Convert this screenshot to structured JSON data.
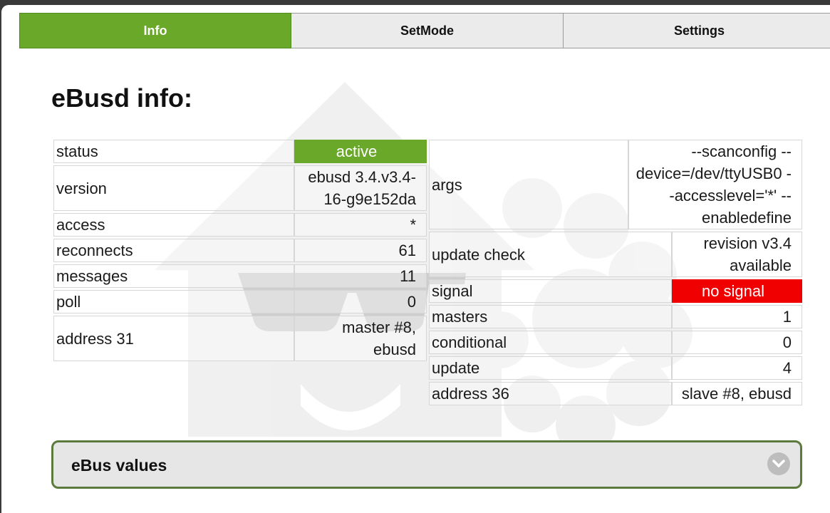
{
  "tabs": [
    {
      "label": "Info",
      "active": true
    },
    {
      "label": "SetMode",
      "active": false
    },
    {
      "label": "Settings",
      "active": false
    }
  ],
  "heading": "eBusd info:",
  "left_table": {
    "rows": [
      {
        "key": "status",
        "value": "active"
      },
      {
        "key": "version",
        "value": "ebusd 3.4.v3.4-16-g9e152da"
      },
      {
        "key": "access",
        "value": "*"
      },
      {
        "key": "reconnects",
        "value": "61"
      },
      {
        "key": "messages",
        "value": "11"
      },
      {
        "key": "poll",
        "value": "0"
      },
      {
        "key": "address 31",
        "value": "master #8, ebusd"
      }
    ]
  },
  "right_table": {
    "args": {
      "key": "args",
      "value": "--scanconfig --device=/dev/ttyUSB0 --accesslevel='*' --enabledefine"
    },
    "rows": [
      {
        "key": "update check",
        "value": "revision v3.4 available"
      },
      {
        "key": "signal",
        "value": "no signal"
      },
      {
        "key": "masters",
        "value": "1"
      },
      {
        "key": "conditional",
        "value": "0"
      },
      {
        "key": "update",
        "value": "4"
      },
      {
        "key": "address 36",
        "value": "slave #8, ebusd"
      }
    ]
  },
  "collapsible": {
    "title": "eBus values",
    "icon": "chevron-down-icon"
  },
  "colors": {
    "accent_green": "#6aa82a",
    "alert_red": "#f00000",
    "panel_border": "#5b7a3d"
  }
}
